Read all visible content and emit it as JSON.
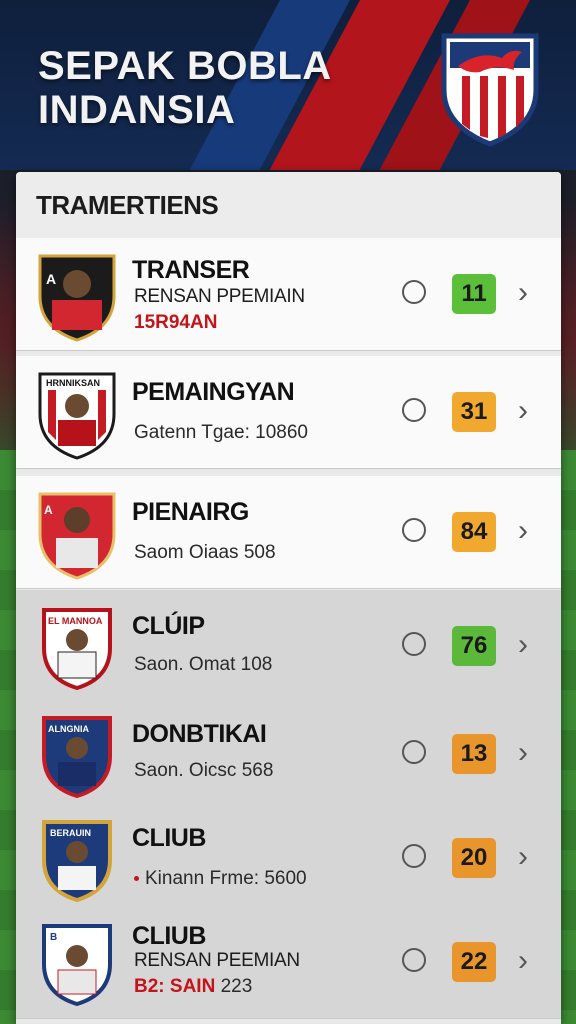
{
  "header": {
    "title_line1": "SEPAK BOBLA",
    "title_line2": "INDANSIA",
    "logo_icon": "club-crest-shield-icon"
  },
  "panel": {
    "heading": "TRAMERTIENS"
  },
  "rows": [
    {
      "title": "TRANSER",
      "line1": "RENSAN PPEMIAIN",
      "line2": "15R94AN",
      "score": "11",
      "score_color": "#5cbf3a"
    },
    {
      "title": "PEMAINGYAN",
      "line1": "",
      "line2": "Gatenn Tgae: 10860",
      "score": "31",
      "score_color": "#f0a82e"
    },
    {
      "title": "PIENAIRG",
      "line1": "",
      "line2": "Saom Oiaas 508",
      "score": "84",
      "score_color": "#f0a82e"
    },
    {
      "title": "CLÚIP",
      "line1": "",
      "line2": "Saon. Omat 108",
      "score": "76",
      "score_color": "#5cb83a"
    },
    {
      "title": "DONBTIKAI",
      "line1": "",
      "line2": "Saon. Oicsc 568",
      "score": "13",
      "score_color": "#e8952c"
    },
    {
      "title": "CLIUB",
      "line1": "",
      "line2": "Kinann Frme: 5600",
      "score": "20",
      "score_color": "#e8952c"
    },
    {
      "title": "CLIUB",
      "line1": "RENSAN PEEMIAN",
      "line2": "B2: SAIN",
      "line2b": "223",
      "score": "22",
      "score_color": "#e8952c"
    }
  ],
  "avatar_badges": [
    "A",
    "HRNNIKSAN",
    "A",
    "EL MANNOA",
    "ALNGNIA",
    "BERAUIN",
    "B"
  ]
}
